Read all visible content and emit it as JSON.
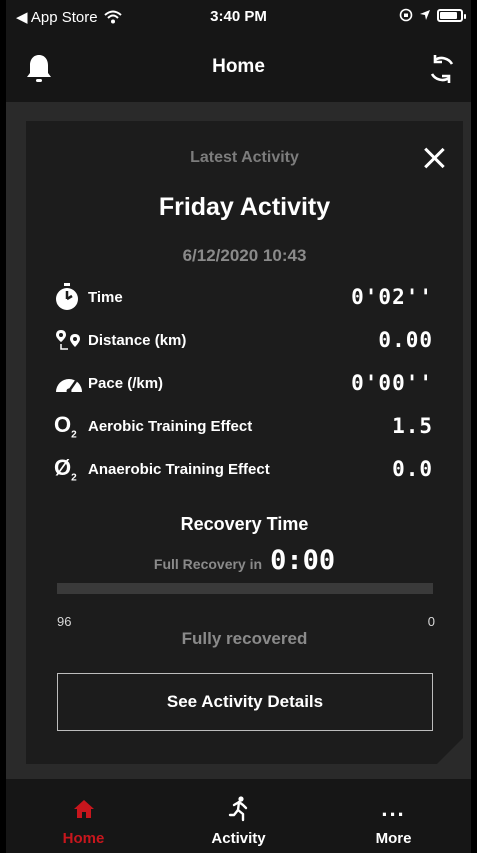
{
  "status_bar": {
    "back_label": "◀ App Store",
    "time": "3:40 PM"
  },
  "nav": {
    "title": "Home"
  },
  "card": {
    "header": "Latest Activity",
    "title": "Friday Activity",
    "datetime": "6/12/2020 10:43",
    "metrics": [
      {
        "icon": "stopwatch-icon",
        "label": "Time",
        "value": "0'02''"
      },
      {
        "icon": "route-icon",
        "label": "Distance (km)",
        "value": "0.00"
      },
      {
        "icon": "speedometer-icon",
        "label": "Pace (/km)",
        "value": "0'00''"
      },
      {
        "icon": "aerobic-o2-icon",
        "label": "Aerobic Training Effect",
        "value": "1.5",
        "icon_text": "O",
        "icon_sub": "2"
      },
      {
        "icon": "anaerobic-o2-icon",
        "label": "Anaerobic Training Effect",
        "value": "0.0",
        "icon_text": "Ø",
        "icon_sub": "2"
      }
    ],
    "recovery": {
      "title": "Recovery Time",
      "full_label": "Full Recovery in",
      "value": "0:00",
      "scale_left": "96",
      "scale_right": "0",
      "status": "Fully recovered"
    },
    "details_button": "See Activity Details"
  },
  "tabs": [
    {
      "label": "Home",
      "icon": "home-icon",
      "active": true
    },
    {
      "label": "Activity",
      "icon": "runner-icon",
      "active": false
    },
    {
      "label": "More",
      "icon": "more-dots-icon",
      "active": false,
      "icon_text": "..."
    }
  ],
  "colors": {
    "accent_red": "#c8161d",
    "card_bg": "#1c1c1c",
    "page_bg": "#2a2a2a",
    "bar_bg": "#161616"
  }
}
